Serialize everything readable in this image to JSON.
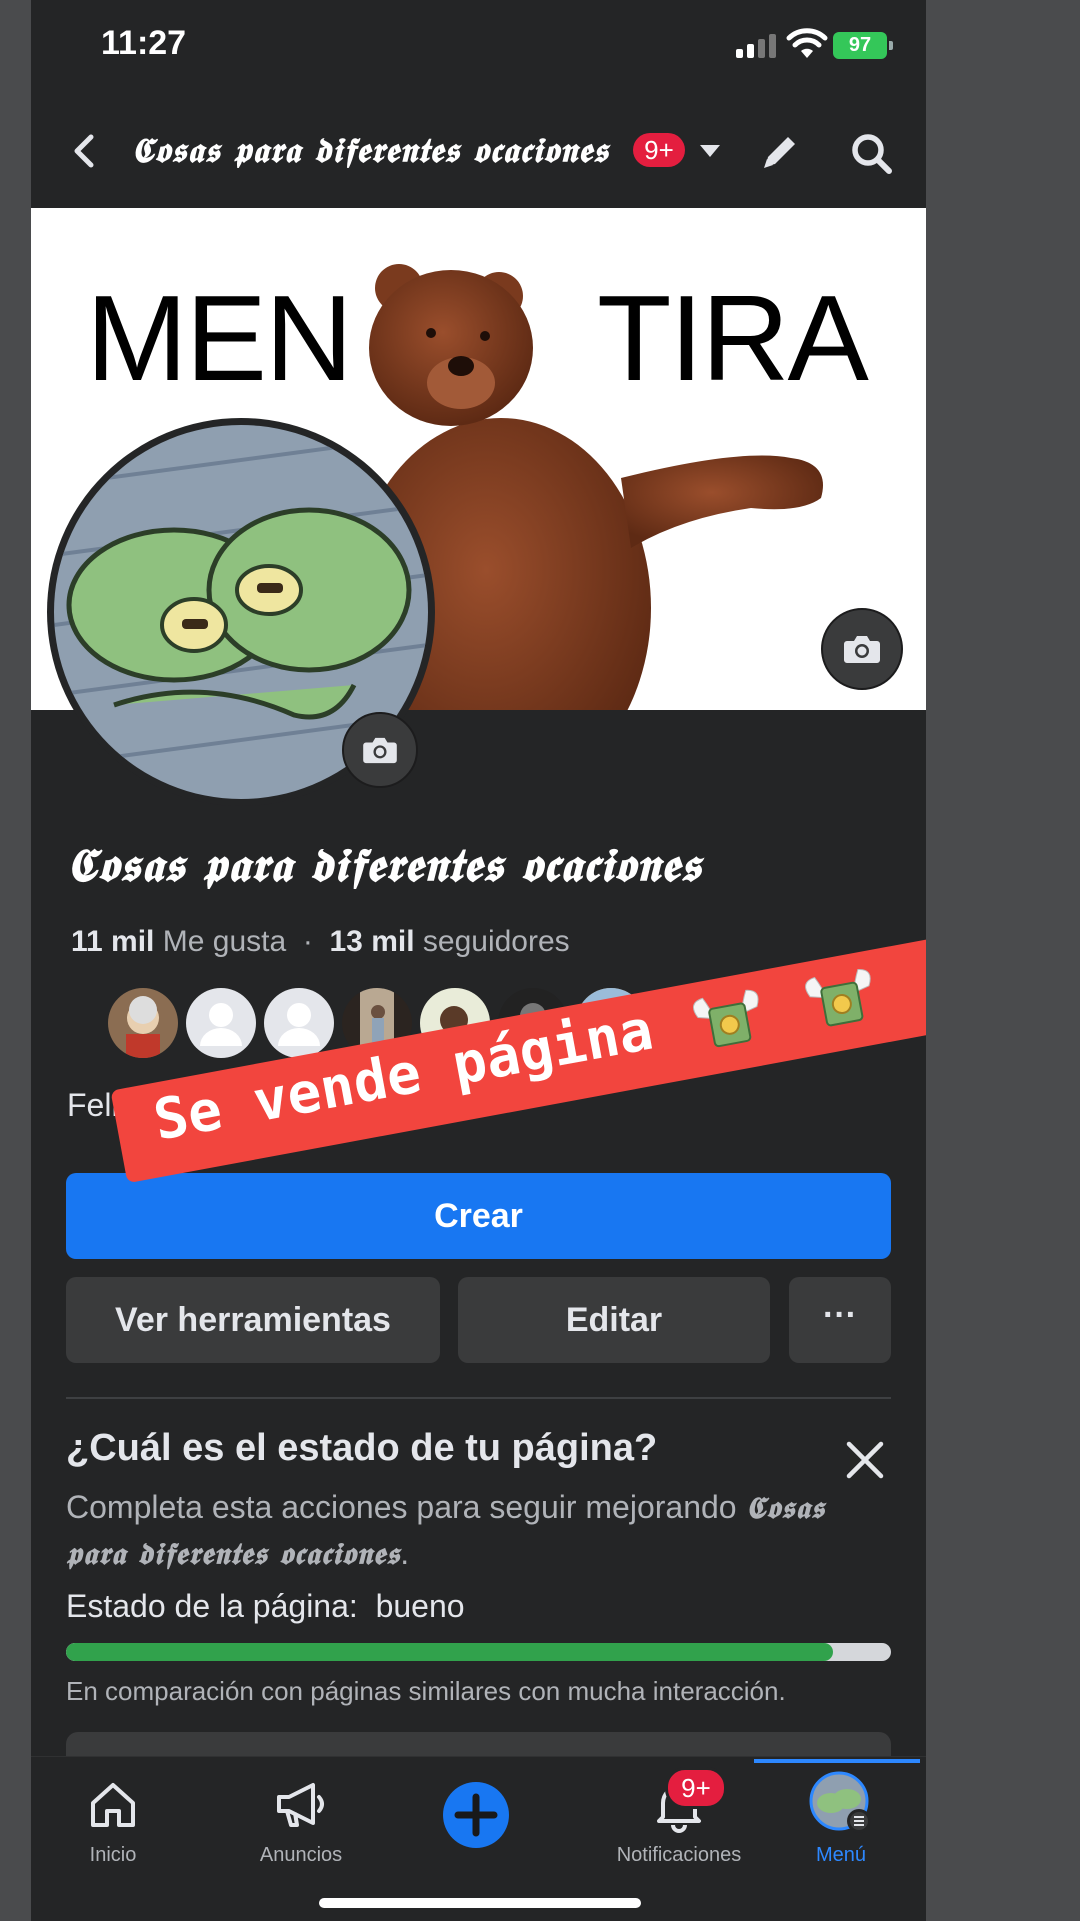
{
  "status_bar": {
    "time": "11:27",
    "battery": "97"
  },
  "header": {
    "title": "𝕮𝖔𝖘𝖆𝖘 𝖕𝖆𝖗𝖆 𝖉𝖎𝖋𝖊𝖗𝖊𝖓𝖙𝖊𝖘 𝖔𝖈𝖆𝖈𝖎𝖔𝖓𝖊𝖘",
    "badge": "9+"
  },
  "cover": {
    "text_left": "MEN",
    "text_right": "TIRA"
  },
  "page": {
    "name": "𝕮𝖔𝖘𝖆𝖘 𝖕𝖆𝖗𝖆 𝖉𝖎𝖋𝖊𝖗𝖊𝖓𝖙𝖊𝖘 𝖔𝖈𝖆𝖈𝖎𝖔𝖓𝖊𝖘",
    "likes_count": "11 mil",
    "likes_label": "Me gusta",
    "separator": "·",
    "followers_count": "13 mil",
    "followers_label": "seguidores",
    "more_followers": "···",
    "about": "Feli"
  },
  "sticker": {
    "text": "Se vende página"
  },
  "actions": {
    "create": "Crear",
    "tools": "Ver herramientas",
    "edit": "Editar",
    "more": "···"
  },
  "health": {
    "title": "¿Cuál es el estado de tu página?",
    "desc_before": "Completa esta acciones para seguir mejorando ",
    "desc_page": "𝕮𝖔𝖘𝖆𝖘 𝖕𝖆𝖗𝖆 𝖉𝖎𝖋𝖊𝖗𝖊𝖓𝖙𝖊𝖘 𝖔𝖈𝖆𝖈𝖎𝖔𝖓𝖊𝖘",
    "desc_after": ".",
    "status_label": "Estado de la página:",
    "status_value": "bueno",
    "progress": 0.93,
    "compare": "En comparación con páginas similares con mucha interacción."
  },
  "nav": {
    "items": [
      {
        "label": "Inicio"
      },
      {
        "label": "Anuncios"
      },
      {
        "label": ""
      },
      {
        "label": "Notificaciones"
      },
      {
        "label": "Menú"
      }
    ],
    "badge": "9+",
    "active_index": 4
  },
  "colors": {
    "background": "#242526",
    "primary": "#1877f2",
    "progress": "#31a24c",
    "sticker": "#f2453e",
    "badge": "#e41e3f",
    "active_tab": "#2d88ff"
  }
}
